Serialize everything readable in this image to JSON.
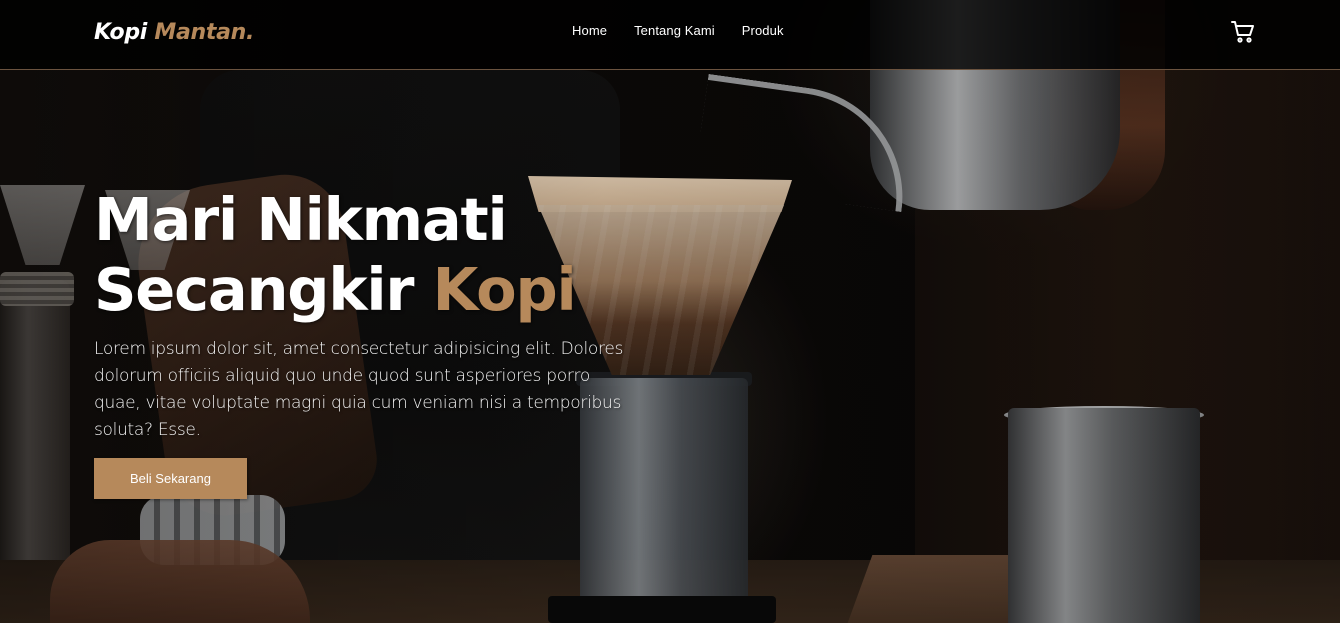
{
  "brand": {
    "name_part1": "Kopi",
    "name_part2": "Mantan."
  },
  "nav": {
    "items": [
      {
        "label": "Home"
      },
      {
        "label": "Tentang Kami"
      },
      {
        "label": "Produk"
      }
    ],
    "cart_icon": "shopping-cart-icon"
  },
  "hero": {
    "title_line1": "Mari Nikmati",
    "title_line2_part1": "Secangkir",
    "title_line2_accent": "Kopi",
    "description": "Lorem ipsum dolor sit, amet consectetur adipisicing elit. Dolores dolorum officiis aliquid quo unde quod sunt asperiores porro quae, vitae voluptate magni quia cum veniam nisi a temporibus soluta? Esse.",
    "cta_label": "Beli Sekarang"
  },
  "colors": {
    "accent": "#b6895b",
    "navbar_bg": "#000000",
    "text": "#ffffff"
  }
}
